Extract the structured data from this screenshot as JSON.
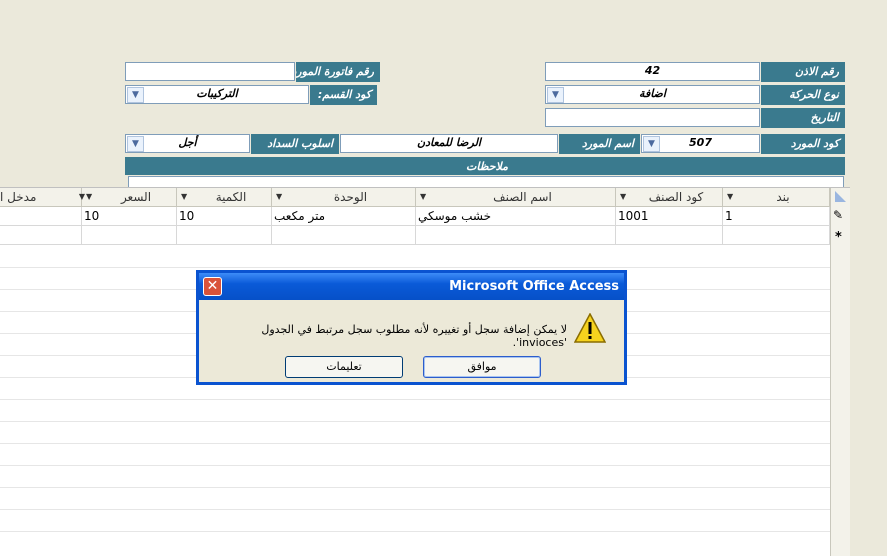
{
  "form": {
    "permit_no_label": "رقم الاذن",
    "permit_no_value": "42",
    "supplier_invoice_label": "رقم فاتورة المورد",
    "supplier_invoice_value": "",
    "movement_type_label": "نوع الحركة",
    "movement_type_value": "اضافة",
    "section_code_label": "كود القسم:",
    "section_code_value": "التركيبات",
    "date_label": "التاريخ",
    "date_value": "",
    "supplier_code_label": "كود المورد",
    "supplier_code_value": "507",
    "supplier_name_label": "اسم المورد",
    "supplier_name_value": "الرضا للمعادن",
    "payment_method_label": "اسلوب السداد",
    "payment_method_value": "أجل",
    "notes_label": "ملاحظات",
    "notes_value": ""
  },
  "grid": {
    "columns": [
      "بند",
      "كود الصنف",
      "اسم الصنف",
      "الوحدة",
      "الكمية",
      "السعر",
      "مدخل ا"
    ],
    "rows": [
      {
        "item": "1",
        "code": "1001",
        "name": "خشب موسكي",
        "unit": "متر مكعب",
        "qty": "10",
        "price": "10"
      }
    ],
    "new_row_marker": "*",
    "edit_marker": "✎"
  },
  "dialog": {
    "title": "Microsoft Office Access",
    "message": "لا يمكن إضافة سجل أو تغييره لأنه مطلوب سجل مرتبط في الجدول 'invioces'.",
    "ok_label": "موافق",
    "help_label": "تعليمات",
    "icon": "warning-icon"
  }
}
